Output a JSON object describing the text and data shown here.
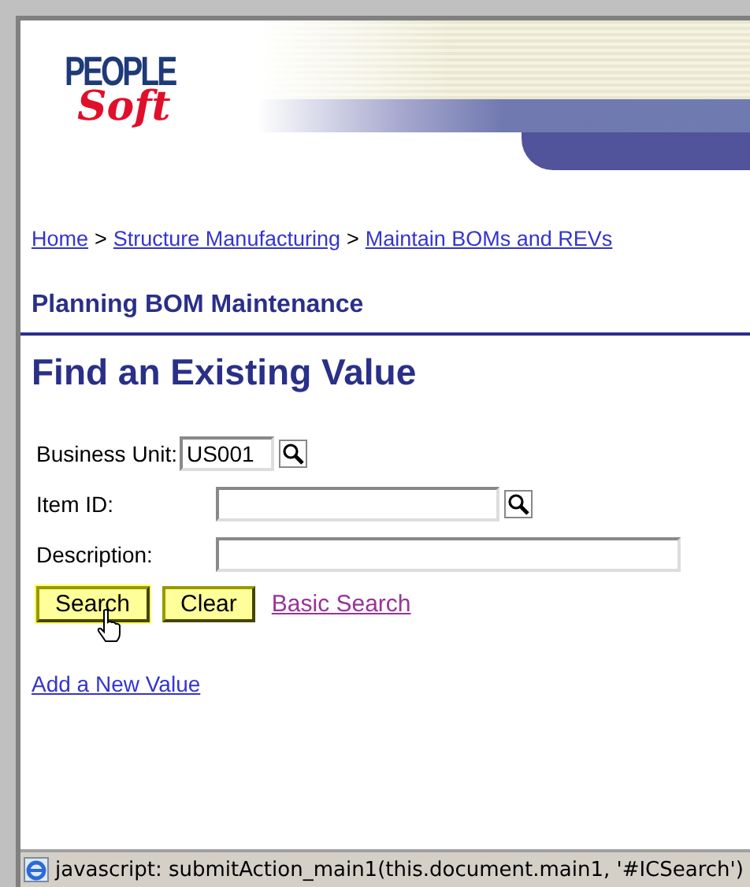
{
  "logo": {
    "top": "PEOPLE",
    "bottom": "Soft"
  },
  "breadcrumb": [
    {
      "label": "Home"
    },
    {
      "label": "Structure Manufacturing"
    },
    {
      "label": "Maintain BOMs and REVs"
    }
  ],
  "breadcrumb_separator": ">",
  "page_title": "Planning BOM Maintenance",
  "heading": "Find an Existing Value",
  "fields": [
    {
      "label": "Business Unit:",
      "value": "US001",
      "lookup": true,
      "kind": "short"
    },
    {
      "label": "Item ID:",
      "lookup": true,
      "kind": "medium"
    },
    {
      "label": "Description:",
      "lookup": false,
      "kind": "long"
    }
  ],
  "buttons": [
    {
      "label": "Search",
      "hovered": true
    },
    {
      "label": "Clear",
      "hovered": false
    }
  ],
  "basic_search_link": "Basic Search",
  "add_link": "Add a New Value",
  "status_bar": "javascript: submitAction_main1(this.document.main1, '#ICSearch')"
}
